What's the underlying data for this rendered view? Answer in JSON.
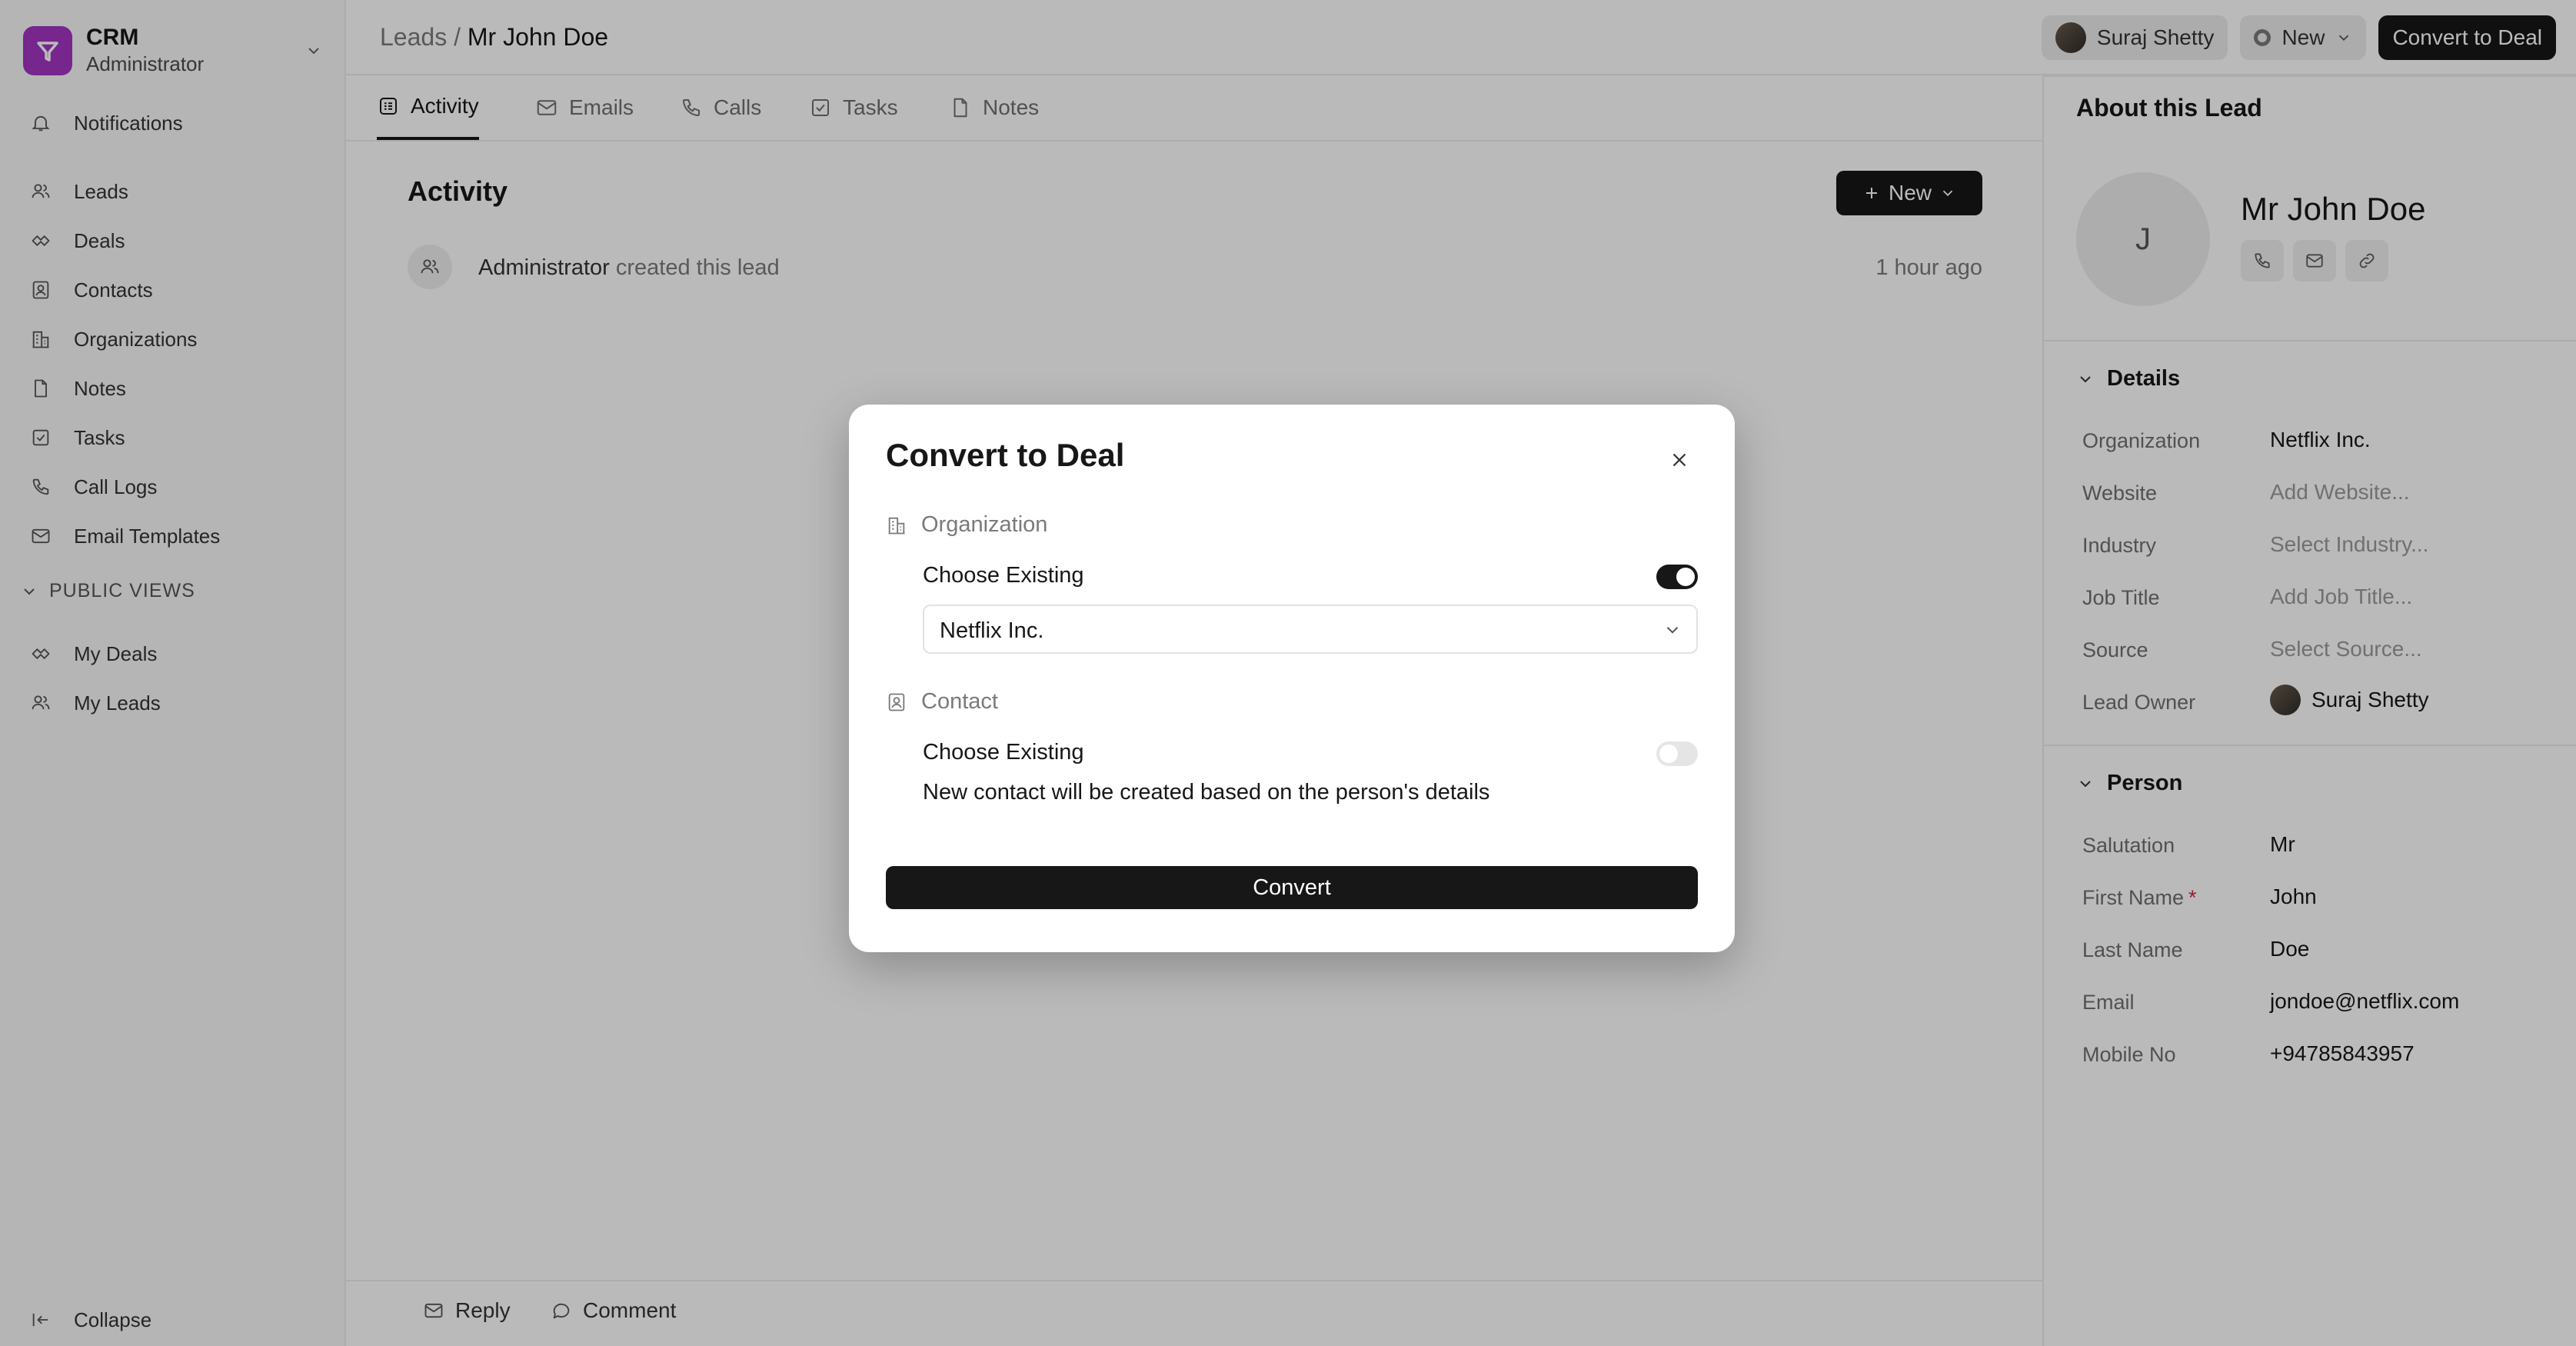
{
  "app": {
    "name": "CRM",
    "role": "Administrator"
  },
  "sidebar": {
    "notifications": "Notifications",
    "items": [
      {
        "label": "Leads",
        "icon": "users-icon"
      },
      {
        "label": "Deals",
        "icon": "deals-icon"
      },
      {
        "label": "Contacts",
        "icon": "contact-icon"
      },
      {
        "label": "Organizations",
        "icon": "building-icon"
      },
      {
        "label": "Notes",
        "icon": "note-icon"
      },
      {
        "label": "Tasks",
        "icon": "task-icon"
      },
      {
        "label": "Call Logs",
        "icon": "phone-icon"
      },
      {
        "label": "Email Templates",
        "icon": "mail-icon"
      }
    ],
    "public_views_label": "PUBLIC VIEWS",
    "public_views": [
      {
        "label": "My Deals",
        "icon": "deals-icon"
      },
      {
        "label": "My Leads",
        "icon": "users-icon"
      }
    ],
    "collapse": "Collapse"
  },
  "header": {
    "breadcrumb_parent": "Leads",
    "breadcrumb_separator": " / ",
    "breadcrumb_current": "Mr John Doe",
    "owner": "Suraj Shetty",
    "status": "New",
    "convert_label": "Convert to Deal"
  },
  "tabs": [
    {
      "label": "Activity",
      "active": true
    },
    {
      "label": "Emails",
      "active": false
    },
    {
      "label": "Calls",
      "active": false
    },
    {
      "label": "Tasks",
      "active": false
    },
    {
      "label": "Notes",
      "active": false
    }
  ],
  "activity": {
    "title": "Activity",
    "new_label": "New",
    "feed": [
      {
        "actor": "Administrator",
        "action": " created this lead",
        "time": "1 hour ago"
      }
    ]
  },
  "bottom": {
    "reply": "Reply",
    "comment": "Comment"
  },
  "right_panel": {
    "title": "About this Lead",
    "initial": "J",
    "name": "Mr John Doe",
    "details_title": "Details",
    "details": [
      {
        "label": "Organization",
        "value": "Netflix Inc.",
        "placeholder": false
      },
      {
        "label": "Website",
        "value": "Add Website...",
        "placeholder": true
      },
      {
        "label": "Industry",
        "value": "Select Industry...",
        "placeholder": true
      },
      {
        "label": "Job Title",
        "value": "Add Job Title...",
        "placeholder": true
      },
      {
        "label": "Source",
        "value": "Select Source...",
        "placeholder": true
      },
      {
        "label": "Lead Owner",
        "value": "Suraj Shetty",
        "placeholder": false
      }
    ],
    "person_title": "Person",
    "person": [
      {
        "label": "Salutation",
        "value": "Mr"
      },
      {
        "label": "First Name",
        "value": "John",
        "required_mark": "*"
      },
      {
        "label": "Last Name",
        "value": "Doe"
      },
      {
        "label": "Email",
        "value": "jondoe@netflix.com"
      },
      {
        "label": "Mobile No",
        "value": "+94785843957"
      }
    ]
  },
  "modal": {
    "title": "Convert to Deal",
    "organization": {
      "section": "Organization",
      "choose_label": "Choose Existing",
      "toggle_on": true,
      "selected": "Netflix Inc."
    },
    "contact": {
      "section": "Contact",
      "choose_label": "Choose Existing",
      "toggle_on": false,
      "note": "New contact will be created based on the person's details"
    },
    "convert_label": "Convert"
  },
  "colors": {
    "brand": "#a235c2",
    "dark": "#171717",
    "required": "#d7263d"
  }
}
